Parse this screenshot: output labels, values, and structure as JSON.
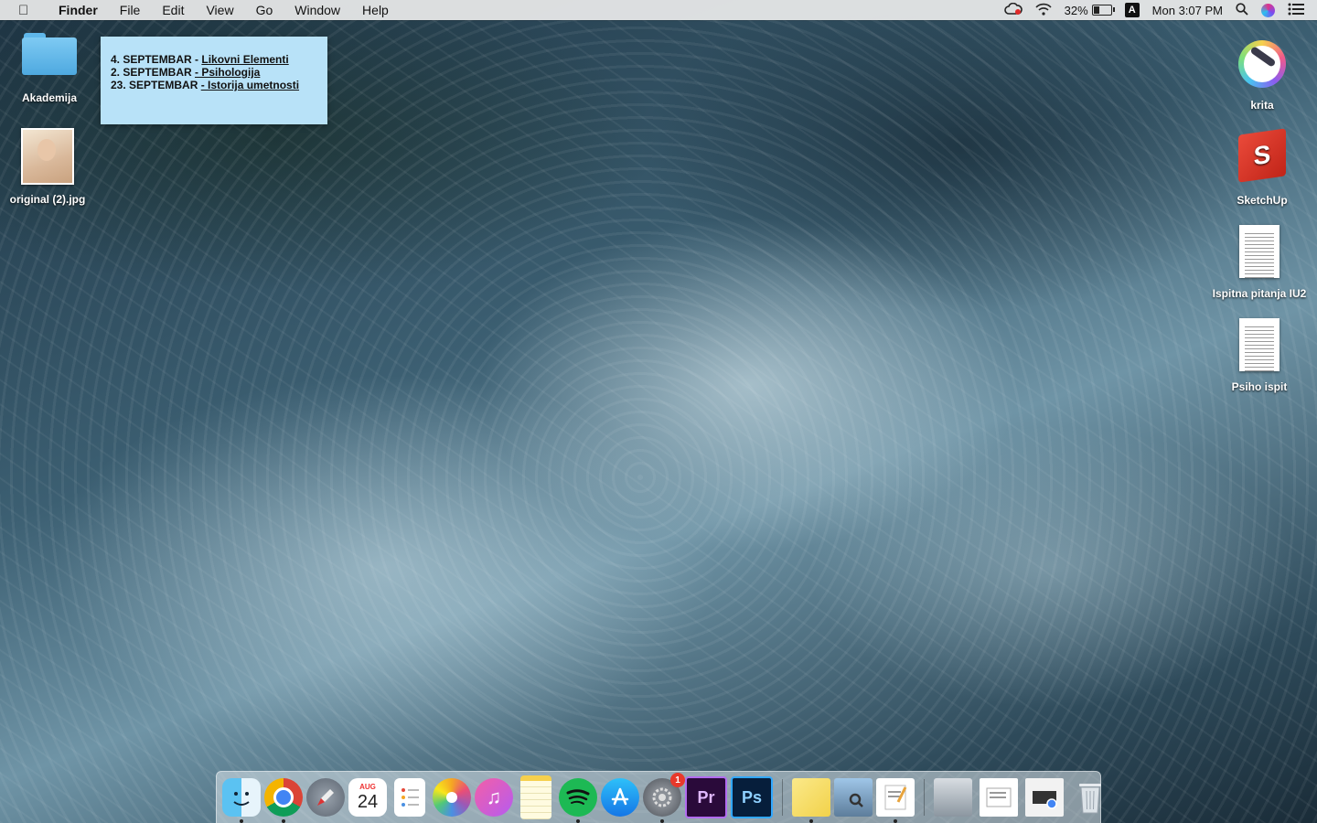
{
  "menubar": {
    "app_name": "Finder",
    "menus": [
      "File",
      "Edit",
      "View",
      "Go",
      "Window",
      "Help"
    ],
    "battery_percent": "32%",
    "battery_level": 0.32,
    "input_source": "A",
    "clock": "Mon 3:07 PM"
  },
  "sticky_note": {
    "lines": [
      {
        "prefix": "4. SEPTEMBAR - ",
        "subject": "Likovni Elementi"
      },
      {
        "prefix": "2. SEPTEMBAR ",
        "subject": "- Psihologija"
      },
      {
        "prefix": "23. SEPTEMBAR ",
        "subject": "- Istorija umetnosti"
      }
    ]
  },
  "desktop_icons": {
    "akademija": "Akademija",
    "original_jpg": "original (2).jpg",
    "krita": "krita",
    "sketchup": "SketchUp",
    "ispitna": "Ispitna pitanja IU2",
    "psiho": "Psiho ispit"
  },
  "dock": {
    "calendar_month": "AUG",
    "calendar_day": "24",
    "system_prefs_badge": "1",
    "premiere_label": "Pr",
    "photoshop_label": "Ps"
  }
}
